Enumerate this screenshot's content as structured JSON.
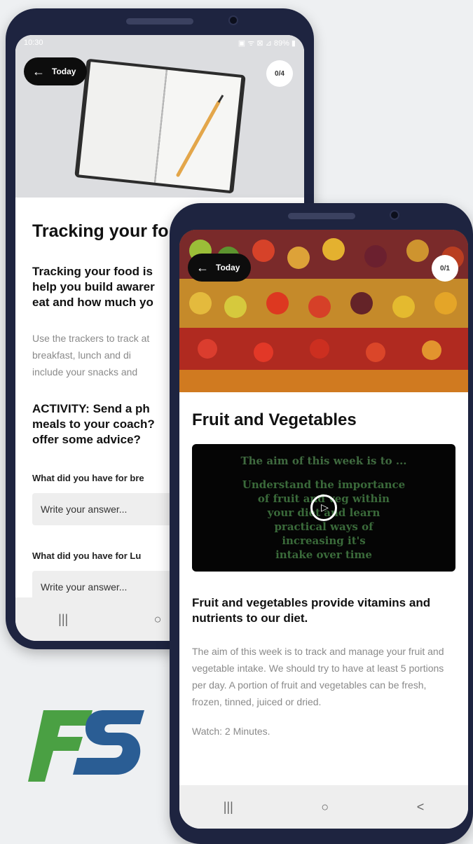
{
  "colors": {
    "frame": "#1e2440",
    "logo_green": "#4aa043",
    "logo_blue": "#2a5d94",
    "video_text": "#3a6a3a"
  },
  "phone1": {
    "status": {
      "time": "10:30",
      "icons": "▣ ᯤ ⊠ ⊿ 89% ▮"
    },
    "back_label": "Today",
    "counter": "0/4",
    "title": "Tracking your fo",
    "subhead": "Tracking your food is help you build awarer eat and how much yo",
    "body": "Use the trackers to track at breakfast, lunch and di include your snacks and",
    "activity": "ACTIVITY: Send a ph meals to your coach? offer some advice?",
    "question1": "What did you have for bre",
    "answer1_placeholder": "Write your answer...",
    "question2": "What did you have for Lu",
    "answer2_placeholder": "Write your answer...",
    "nav": {
      "recent_icon": "|||",
      "home_icon": "○"
    }
  },
  "phone2": {
    "back_label": "Today",
    "counter": "0/1",
    "title": "Fruit and Vegetables",
    "video": {
      "line1": "The aim of this week is to ...",
      "line2": "Understand the importance",
      "line3": "of fruit and veg within",
      "line4": "your diet and learn",
      "line5": "practical ways of",
      "line6": "increasing it's",
      "line7": "intake over time"
    },
    "subhead": "Fruit and vegetables provide vitamins and nutrients to our diet.",
    "body": "The aim of this week is to track and manage your fruit and vegetable intake. We should try to have at least 5 portions per day. A portion of fruit and vegetables can be fresh, frozen, tinned, juiced or dried.",
    "watch": "Watch: 2 Minutes.",
    "nav": {
      "recent_icon": "|||",
      "home_icon": "○",
      "back_icon": "<"
    }
  },
  "logo": {
    "text": "FS"
  }
}
